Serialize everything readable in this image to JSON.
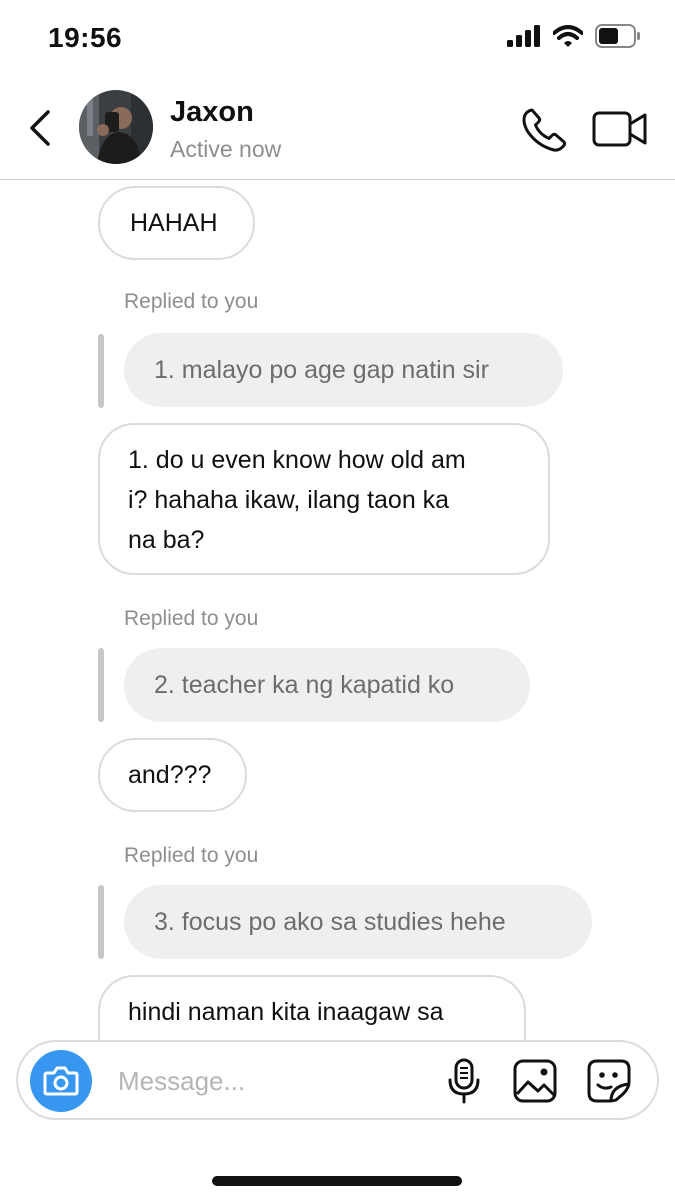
{
  "status_bar": {
    "time": "19:56",
    "icons": [
      "signal-icon",
      "wifi-icon",
      "battery-icon"
    ]
  },
  "header": {
    "name": "Jaxon",
    "status": "Active now",
    "icons": [
      "back-icon",
      "phone-icon",
      "video-icon"
    ]
  },
  "messages": [
    {
      "type": "text",
      "text": "HAHAH"
    },
    {
      "type": "reply",
      "label": "Replied to you",
      "quoted": "1. malayo po age gap natin sir"
    },
    {
      "type": "text",
      "lines": [
        "1. do u even know how old am",
        "i? hahaha ikaw, ilang taon ka",
        "na ba?"
      ]
    },
    {
      "type": "reply",
      "label": "Replied to you",
      "quoted": "2. teacher ka ng kapatid ko"
    },
    {
      "type": "text",
      "text": "and???"
    },
    {
      "type": "reply",
      "label": "Replied to you",
      "quoted": "3. focus po ako sa studies hehe"
    },
    {
      "type": "text",
      "text": "hindi naman kita inaagaw sa"
    }
  ],
  "composer": {
    "placeholder": "Message...",
    "icons": [
      "camera-icon",
      "microphone-icon",
      "gallery-icon",
      "sticker-icon"
    ]
  },
  "colors": {
    "accent": "#3797f0",
    "bubble_border": "#dbdbdb",
    "quoted_bg": "#efefef",
    "secondary_text": "#8e8e8e"
  }
}
